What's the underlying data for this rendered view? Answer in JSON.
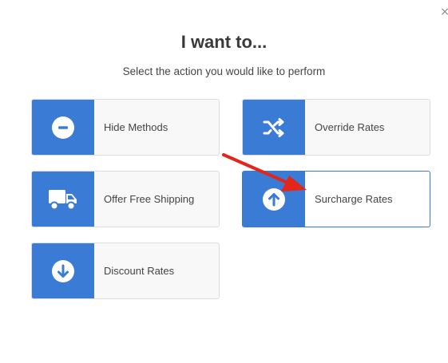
{
  "dialog": {
    "close_symbol": "×",
    "title": "I want to...",
    "subtitle": "Select the action you would like to perform"
  },
  "actions": [
    {
      "label": "Hide Methods",
      "icon": "minus-circle-icon"
    },
    {
      "label": "Override Rates",
      "icon": "shuffle-icon"
    },
    {
      "label": "Offer Free Shipping",
      "icon": "truck-icon"
    },
    {
      "label": "Surcharge Rates",
      "icon": "arrow-up-circle-icon",
      "highlighted": true
    },
    {
      "label": "Discount Rates",
      "icon": "arrow-down-circle-icon"
    }
  ],
  "colors": {
    "icon_panel": "#3a7bd5",
    "card_bg": "#f8f8f8",
    "annotation_arrow": "#e3251a"
  }
}
